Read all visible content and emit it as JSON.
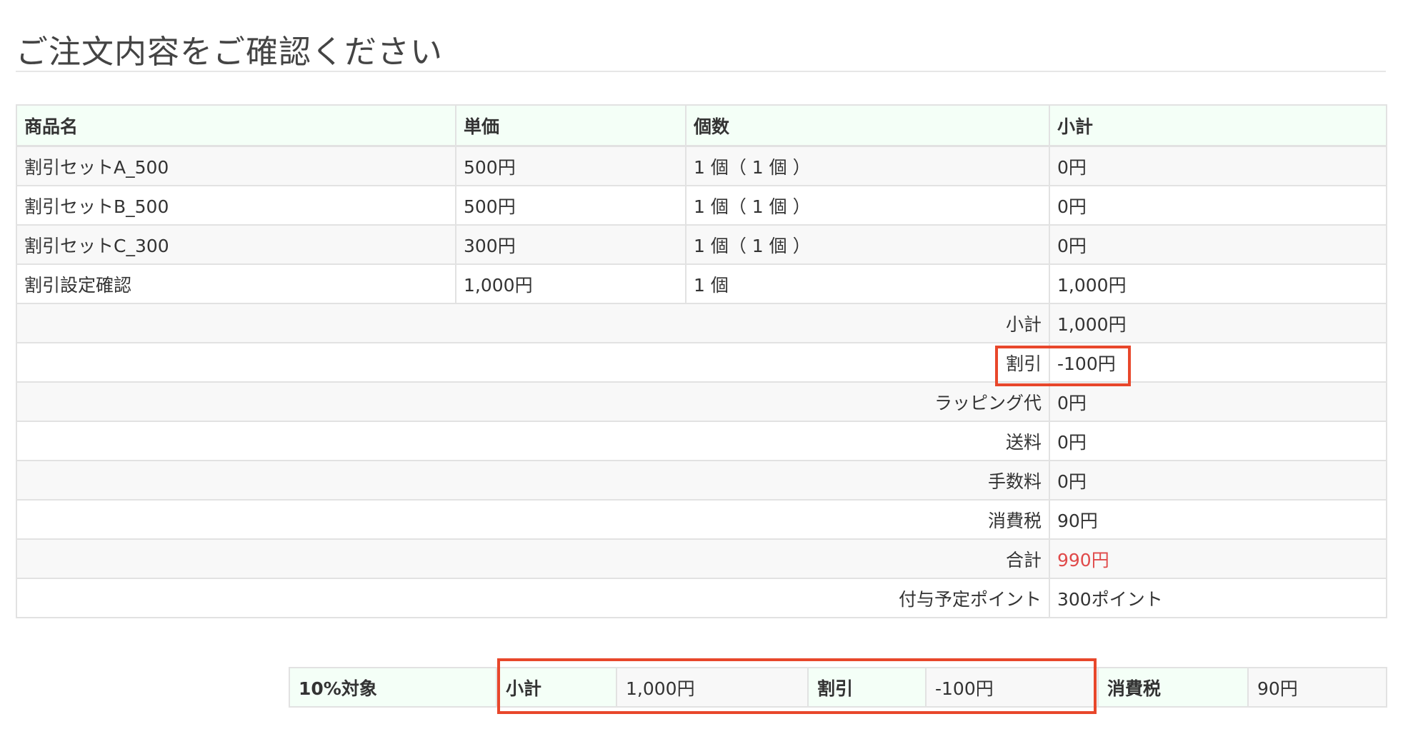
{
  "page": {
    "title": "ご注文内容をご確認ください"
  },
  "order_table": {
    "headers": {
      "product": "商品名",
      "unit_price": "単価",
      "quantity": "個数",
      "subtotal": "小計"
    },
    "rows": [
      {
        "product": "割引セットA_500",
        "unit_price": "500円",
        "quantity": "1 個（ 1 個 ）",
        "subtotal": "0円"
      },
      {
        "product": "割引セットB_500",
        "unit_price": "500円",
        "quantity": "1 個（ 1 個 ）",
        "subtotal": "0円"
      },
      {
        "product": "割引セットC_300",
        "unit_price": "300円",
        "quantity": "1 個（ 1 個 ）",
        "subtotal": "0円"
      },
      {
        "product": "割引設定確認",
        "unit_price": "1,000円",
        "quantity": "1 個",
        "subtotal": "1,000円"
      }
    ],
    "summary": {
      "subtotal": {
        "label": "小計",
        "value": "1,000円"
      },
      "discount": {
        "label": "割引",
        "value": "-100円"
      },
      "wrapping": {
        "label": "ラッピング代",
        "value": "0円"
      },
      "shipping": {
        "label": "送料",
        "value": "0円"
      },
      "fee": {
        "label": "手数料",
        "value": "0円"
      },
      "tax": {
        "label": "消費税",
        "value": "90円"
      },
      "total": {
        "label": "合計",
        "value": "990円"
      },
      "points": {
        "label": "付与予定ポイント",
        "value": "300ポイント"
      }
    }
  },
  "tax_table": {
    "category": "10%対象",
    "subtotal_label": "小計",
    "subtotal_value": "1,000円",
    "discount_label": "割引",
    "discount_value": "-100円",
    "tax_label": "消費税",
    "tax_value": "90円"
  },
  "colors": {
    "total_value": "#e04a4a",
    "highlight_box": "#e8472b",
    "header_background": "#f4fff7"
  }
}
